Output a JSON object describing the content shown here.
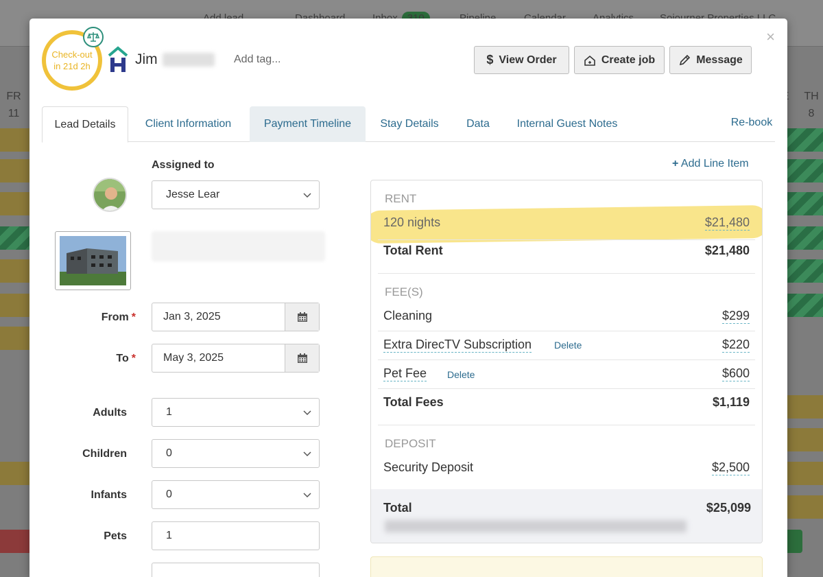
{
  "background": {
    "nav": [
      "Add lead",
      "Dashboard",
      "Inbox",
      "Pipeline",
      "Calendar",
      "Analytics",
      "Sojourner Properties LLC"
    ],
    "inbox_count": "310",
    "days_left": {
      "weekday": "FR",
      "date": "11"
    },
    "days_right": {
      "weekday": "TH",
      "date": "8"
    },
    "day_e": "E"
  },
  "header": {
    "checkout_line1": "Check-out",
    "checkout_line2": "in 21d 2h",
    "guest_name": "Jim",
    "add_tag_placeholder": "Add tag...",
    "buttons": {
      "view_order": "View Order",
      "create_job": "Create job",
      "message": "Message"
    },
    "close": "×"
  },
  "tabs": [
    "Lead Details",
    "Client Information",
    "Payment Timeline",
    "Stay Details",
    "Data",
    "Internal Guest Notes"
  ],
  "rebook": "Re-book",
  "form": {
    "assigned_to_label": "Assigned to",
    "assigned_to_value": "Jesse Lear",
    "from_label": "From",
    "from_value": "Jan 3, 2025",
    "to_label": "To",
    "to_value": "May 3, 2025",
    "adults_label": "Adults",
    "adults_value": "1",
    "children_label": "Children",
    "children_value": "0",
    "infants_label": "Infants",
    "infants_value": "0",
    "pets_label": "Pets",
    "pets_value": "1"
  },
  "pricing": {
    "add_line_item": "Add Line Item",
    "rent_header": "RENT",
    "nights_label": "120 nights",
    "nights_amount": "$21,480",
    "total_rent_label": "Total Rent",
    "total_rent_amount": "$21,480",
    "fees_header": "FEE(S)",
    "fees": [
      {
        "label": "Cleaning",
        "amount": "$299",
        "delete": ""
      },
      {
        "label": "Extra DirecTV Subscription",
        "amount": "$220",
        "delete": "Delete"
      },
      {
        "label": "Pet Fee",
        "amount": "$600",
        "delete": "Delete"
      }
    ],
    "total_fees_label": "Total Fees",
    "total_fees_amount": "$1,119",
    "deposit_header": "DEPOSIT",
    "deposit_label": "Security Deposit",
    "deposit_amount": "$2,500",
    "total_label": "Total",
    "total_amount": "$25,099"
  },
  "colors": {
    "accent": "#2c6b8e",
    "checkout_ring": "#f0c23a",
    "highlight": "#f8e27e"
  }
}
